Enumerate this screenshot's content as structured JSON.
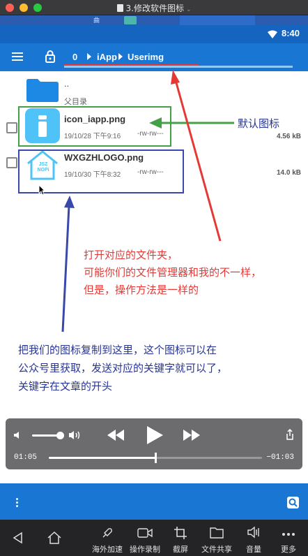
{
  "window": {
    "title": "3.修改软件图标",
    "tab_fragment": "曲"
  },
  "status_bar": {
    "time": "8:40"
  },
  "toolbar": {
    "breadcrumbs": [
      "0",
      "iApp",
      "Userimg"
    ]
  },
  "file_list": {
    "parent": {
      "name": "..",
      "label": "父目录"
    },
    "files": [
      {
        "name": "icon_iapp.png",
        "date": "19/10/28 下午9:16",
        "perms": "-rw-rw---",
        "size": "4.56 kB"
      },
      {
        "name": "WXGZHLOGO.png",
        "date": "19/10/30 下午8:32",
        "perms": "-rw-rw---",
        "size": "14.0 kB"
      }
    ]
  },
  "logo_text": "JSZ NOPi",
  "annotations": {
    "default_icon": "默认图标",
    "open_folder": [
      "打开对应的文件夹，",
      "可能你们的文件管理器和我的不一样，",
      "但是，操作方法是一样的"
    ],
    "copy_icon": [
      "把我们的图标复制到这里，这个图标可以在",
      "公众号里获取，发送对应的关键字就可以了，",
      "关键字在文章的开头"
    ]
  },
  "player": {
    "elapsed": "01:05",
    "remaining": "−01:03",
    "progress_fraction": 0.5,
    "volume_fraction": 0.9
  },
  "emulator_toolbar": {
    "buttons": [
      "海外加速",
      "操作录制",
      "截屏",
      "文件共享",
      "音量",
      "更多"
    ]
  },
  "colors": {
    "status_bar": "#1565c0",
    "toolbar": "#1976d2",
    "annotation_red": "#e53935",
    "annotation_blue": "#283593",
    "highlight_green": "#43a047"
  }
}
